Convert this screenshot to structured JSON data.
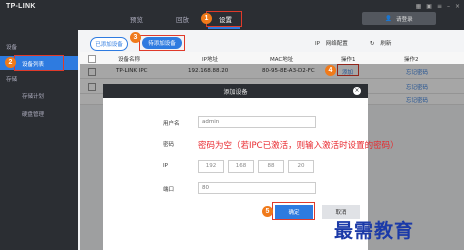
{
  "app": {
    "logo": "TP-LINK",
    "login_button": "请登录"
  },
  "tabs": [
    {
      "label": "预览"
    },
    {
      "label": "回放"
    },
    {
      "label": "设置"
    }
  ],
  "sidebar": {
    "items": [
      {
        "label": "设备"
      },
      {
        "label": "设备列表"
      },
      {
        "label": "存储"
      },
      {
        "label": "存储计划"
      },
      {
        "label": "硬盘管理"
      }
    ]
  },
  "toolbar": {
    "added_devices": "已添加设备",
    "add_device": "待添加设备",
    "ip_config": "网络配置",
    "refresh": "刷新"
  },
  "table": {
    "columns": [
      "设备名称",
      "IP地址",
      "MAC地址",
      "操作1",
      "操作2"
    ],
    "rows": [
      {
        "name": "TP-LINK IPC",
        "ip": "192.168.88.20",
        "mac": "80-95-8E-A3-D2-FC",
        "op1": "添加",
        "op2": "忘记密码"
      },
      {
        "op2": "忘记密码"
      },
      {
        "op2": "忘记密码"
      }
    ]
  },
  "dialog": {
    "title": "添加设备",
    "username_label": "用户名",
    "username_value": "admin",
    "password_label": "密码",
    "ip_label": "IP",
    "ip_segments": [
      "192",
      "168",
      "88",
      "20"
    ],
    "port_label": "端口",
    "port_value": "80",
    "ok": "确定",
    "cancel": "取消"
  },
  "annotation": {
    "note": "密码为空（若IPC已激活，则输入激活时设置的密码）",
    "steps": [
      "1",
      "2",
      "3",
      "4",
      "5"
    ],
    "color": "#e8282e",
    "step_color": "#f07a1a"
  },
  "watermark": "最需教育",
  "colors": {
    "accent": "#2e7be0",
    "dark": "#2b2e33"
  }
}
